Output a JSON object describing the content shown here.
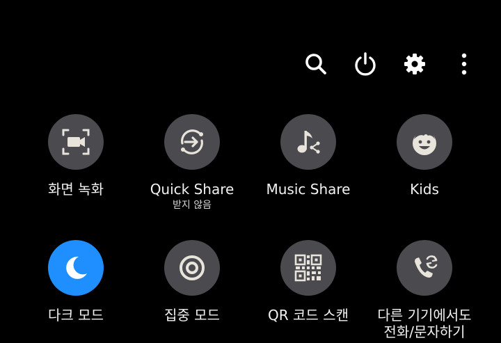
{
  "top_bar": {
    "icons": [
      "search-icon",
      "power-icon",
      "settings-icon",
      "more-options-icon"
    ]
  },
  "colors": {
    "background": "#000000",
    "tile_inactive": "#4a4a4f",
    "tile_active": "#1f8fff",
    "icon": "#e8e4dc",
    "text": "#f2f2f2"
  },
  "tiles": [
    {
      "label": "화면 녹화",
      "icon": "screen-record-icon",
      "active": false
    },
    {
      "label": "Quick Share",
      "sublabel": "받지 않음",
      "icon": "quick-share-icon",
      "active": false
    },
    {
      "label": "Music Share",
      "icon": "music-share-icon",
      "active": false
    },
    {
      "label": "Kids",
      "icon": "kids-icon",
      "active": false
    },
    {
      "label": "다크 모드",
      "icon": "dark-mode-icon",
      "active": true
    },
    {
      "label": "집중 모드",
      "icon": "focus-mode-icon",
      "active": false
    },
    {
      "label": "QR 코드 스캔",
      "icon": "qr-code-icon",
      "active": false
    },
    {
      "label": "다른 기기에서도",
      "label_line2": "전화/문자하기",
      "icon": "call-text-other-devices-icon",
      "active": false
    }
  ]
}
